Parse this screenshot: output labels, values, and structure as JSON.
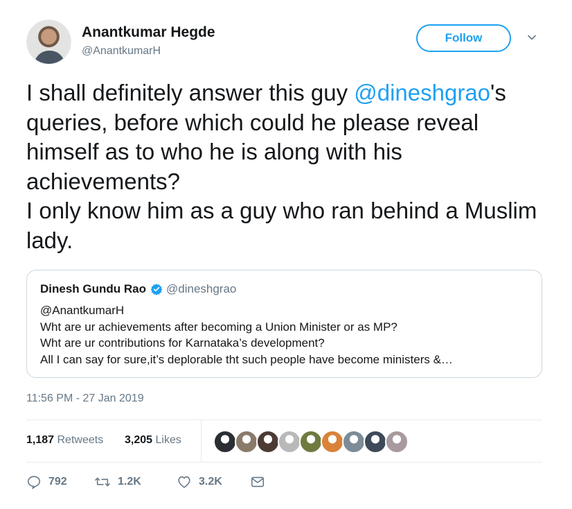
{
  "author": {
    "name": "Anantkumar Hegde",
    "handle": "@AnantkumarH",
    "follow_label": "Follow"
  },
  "tweet": {
    "text_before_mention": "I shall definitely answer this guy ",
    "mention": "@dineshgrao",
    "text_after_mention": "'s queries, before which could he please reveal himself as to who he is along with his achievements?",
    "text_line2": "I only know him as a guy who ran behind a Muslim lady."
  },
  "quoted_tweet": {
    "name": "Dinesh Gundu Rao",
    "handle": "@dineshgrao",
    "lines": [
      "@AnantkumarH",
      "Wht are ur achievements after becoming a Union Minister or as MP?",
      "Wht are ur contributions for Karnataka’s development?",
      "All I can say for sure,it’s deplorable tht such people have become ministers &…"
    ]
  },
  "timestamp": "11:56 PM - 27 Jan 2019",
  "stats": {
    "retweets_count": "1,187",
    "retweets_label": "Retweets",
    "likes_count": "3,205",
    "likes_label": "Likes"
  },
  "liker_avatars": [
    {
      "icon": "avatar",
      "color": "#2b2f33"
    },
    {
      "icon": "avatar",
      "color": "#8a7a6a"
    },
    {
      "icon": "avatar",
      "color": "#4c3b35"
    },
    {
      "icon": "avatar",
      "color": "#b9b9b9"
    },
    {
      "icon": "avatar",
      "color": "#6f7a3f"
    },
    {
      "icon": "avatar",
      "color": "#d9823a"
    },
    {
      "icon": "avatar",
      "color": "#7d8c96"
    },
    {
      "icon": "avatar",
      "color": "#3e4a5a"
    },
    {
      "icon": "avatar",
      "color": "#a89a9e"
    }
  ],
  "actions": {
    "reply_count": "792",
    "retweet_count": "1.2K",
    "like_count": "3.2K"
  },
  "colors": {
    "accent": "#1da1f2",
    "muted": "#657786",
    "border": "#ccd6dd"
  }
}
